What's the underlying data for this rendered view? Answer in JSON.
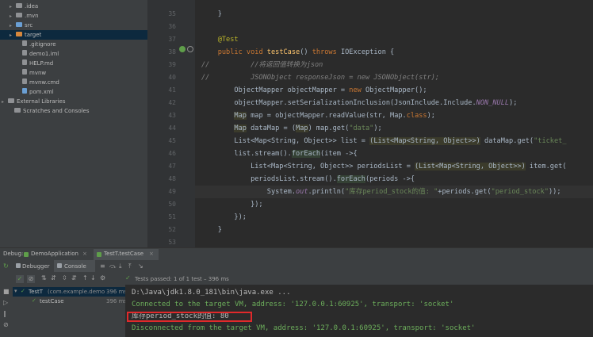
{
  "colors": {
    "accent_green": "#5f9e4a",
    "highlight_box": "#e0292b",
    "console_text": "#6cae5b"
  },
  "project": {
    "items": [
      {
        "label": ".idea",
        "type": "folder",
        "arrow": "▸",
        "color": "#8f9194"
      },
      {
        "label": ".mvn",
        "type": "folder",
        "arrow": "▸",
        "color": "#8f9194"
      },
      {
        "label": "src",
        "type": "folder",
        "arrow": "▸",
        "color": "#6a9fd4"
      },
      {
        "label": "target",
        "type": "folder",
        "arrow": "▸",
        "color": "#d6873c",
        "selected": true
      },
      {
        "label": ".gitignore",
        "type": "file",
        "arrow": "",
        "color": "#8f9194"
      },
      {
        "label": "demo1.iml",
        "type": "file",
        "arrow": "",
        "color": "#8f9194"
      },
      {
        "label": "HELP.md",
        "type": "file",
        "arrow": "",
        "color": "#8f9194"
      },
      {
        "label": "mvnw",
        "type": "file",
        "arrow": "",
        "color": "#8f9194"
      },
      {
        "label": "mvnw.cmd",
        "type": "file",
        "arrow": "",
        "color": "#8f9194"
      },
      {
        "label": "pom.xml",
        "type": "file",
        "arrow": "",
        "color": "#6a9fd4"
      },
      {
        "label": "External Libraries",
        "type": "lib",
        "arrow": "▸",
        "color": "#8f9194"
      },
      {
        "label": "Scratches and Consoles",
        "type": "scratch",
        "arrow": "",
        "color": "#8f9194"
      }
    ]
  },
  "editor": {
    "lines": [
      {
        "num": "35",
        "segs": [
          {
            "t": "    }",
            "c": ""
          }
        ]
      },
      {
        "num": "36",
        "segs": [
          {
            "t": "",
            "c": ""
          }
        ]
      },
      {
        "num": "37",
        "segs": [
          {
            "t": "    @Test",
            "c": "an"
          }
        ]
      },
      {
        "num": "38",
        "segs": [
          {
            "t": "    ",
            "c": ""
          },
          {
            "t": "public void ",
            "c": "kw"
          },
          {
            "t": "testCase",
            "c": "fn"
          },
          {
            "t": "() ",
            "c": ""
          },
          {
            "t": "throws ",
            "c": "kw"
          },
          {
            "t": "IOException {",
            "c": ""
          }
        ]
      },
      {
        "num": "39",
        "segs": [
          {
            "t": "//          //将返回值转换为json",
            "c": "cm"
          }
        ]
      },
      {
        "num": "40",
        "segs": [
          {
            "t": "//          JSONObject responseJson = new JSONObject(str);",
            "c": "cm"
          }
        ]
      },
      {
        "num": "41",
        "segs": [
          {
            "t": "        ObjectMapper objectMapper = ",
            "c": ""
          },
          {
            "t": "new ",
            "c": "kw"
          },
          {
            "t": "ObjectMapper();",
            "c": ""
          }
        ]
      },
      {
        "num": "42",
        "segs": [
          {
            "t": "        objectMapper.setSerializationInclusion(JsonInclude.Include.",
            "c": ""
          },
          {
            "t": "NON_NULL",
            "c": "fd"
          },
          {
            "t": ");",
            "c": ""
          }
        ]
      },
      {
        "num": "43",
        "segs": [
          {
            "t": "        ",
            "c": ""
          },
          {
            "t": "Map",
            "c": "hl2"
          },
          {
            "t": " map = objectMapper.readValue(str, Map.",
            "c": ""
          },
          {
            "t": "class",
            "c": "kw"
          },
          {
            "t": ");",
            "c": ""
          }
        ]
      },
      {
        "num": "44",
        "segs": [
          {
            "t": "        ",
            "c": ""
          },
          {
            "t": "Map",
            "c": "hl2"
          },
          {
            "t": " dataMap = (",
            "c": ""
          },
          {
            "t": "Map",
            "c": "hl2"
          },
          {
            "t": ") map.get(",
            "c": ""
          },
          {
            "t": "\"data\"",
            "c": "st"
          },
          {
            "t": ");",
            "c": ""
          }
        ]
      },
      {
        "num": "45",
        "segs": [
          {
            "t": "        List<Map<String, Object>> list = ",
            "c": ""
          },
          {
            "t": "(List<Map<String, Object>>)",
            "c": "hl2"
          },
          {
            "t": " dataMap.get(",
            "c": ""
          },
          {
            "t": "\"ticket_",
            "c": "st"
          }
        ]
      },
      {
        "num": "46",
        "segs": [
          {
            "t": "        list.stream().",
            "c": ""
          },
          {
            "t": "forEach",
            "c": "hl"
          },
          {
            "t": "(item ->{",
            "c": ""
          }
        ]
      },
      {
        "num": "47",
        "segs": [
          {
            "t": "            List<Map<String, Object>> periodsList = ",
            "c": ""
          },
          {
            "t": "(List<Map<String, Object>>)",
            "c": "hl2"
          },
          {
            "t": " item.get(",
            "c": ""
          }
        ]
      },
      {
        "num": "48",
        "segs": [
          {
            "t": "            periodsList.stream().",
            "c": ""
          },
          {
            "t": "forEach",
            "c": "hl"
          },
          {
            "t": "(periods ->{",
            "c": ""
          }
        ]
      },
      {
        "num": "49",
        "segs": [
          {
            "t": "                System.",
            "c": ""
          },
          {
            "t": "out",
            "c": "fd"
          },
          {
            "t": ".println(",
            "c": ""
          },
          {
            "t": "\"库存period_stock的值: \"",
            "c": "st"
          },
          {
            "t": "+periods.get(",
            "c": ""
          },
          {
            "t": "\"period_stock\"",
            "c": "st"
          },
          {
            "t": "));",
            "c": ""
          }
        ]
      },
      {
        "num": "50",
        "segs": [
          {
            "t": "            });",
            "c": ""
          }
        ]
      },
      {
        "num": "51",
        "segs": [
          {
            "t": "        });",
            "c": ""
          }
        ]
      },
      {
        "num": "52",
        "segs": [
          {
            "t": "    }",
            "c": ""
          }
        ]
      },
      {
        "num": "53",
        "segs": [
          {
            "t": "",
            "c": ""
          }
        ]
      }
    ]
  },
  "debug": {
    "label": "Debug:",
    "tabs": [
      {
        "label": "DemoApplication"
      },
      {
        "label": "TestT.testCase"
      }
    ],
    "subtabs": [
      {
        "label": "Debugger"
      },
      {
        "label": "Console"
      }
    ],
    "tests_passed": "Tests passed: 1 of 1 test – 396 ms"
  },
  "test_tree": {
    "root": {
      "label": "TestT",
      "package": "(com.example.demo",
      "time": "396 ms"
    },
    "child": {
      "label": "testCase",
      "time": "396 ms"
    }
  },
  "console": {
    "lines": [
      {
        "text": "D:\\Java\\jdk1.8.0_181\\bin\\java.exe ...",
        "color": "#bbbbbb"
      },
      {
        "text": "Connected to the target VM, address: '127.0.0.1:60925', transport: 'socket'",
        "color": "#6cae5b"
      },
      {
        "text": "库存period_stock的值: 80",
        "color": "#bbbbbb"
      },
      {
        "text": "Disconnected from the target VM, address: '127.0.0.1:60925', transport: 'socket'",
        "color": "#6cae5b"
      }
    ]
  }
}
